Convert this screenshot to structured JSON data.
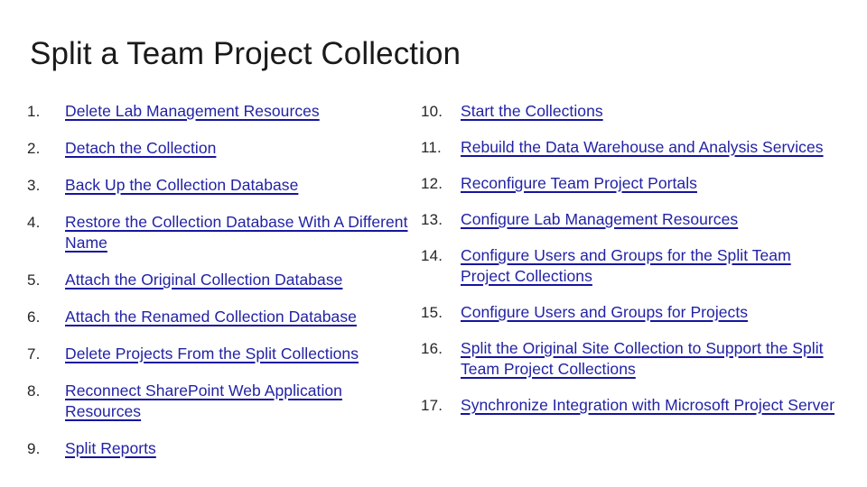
{
  "slide": {
    "title": "Split a Team Project Collection",
    "background_color": "#ffffff",
    "title_color": "#1a1a1a",
    "link_color": "#2222a6",
    "link_underline_color": "#1515a0",
    "number_color": "#262626"
  },
  "columns": {
    "left": {
      "items": [
        {
          "number": "1.",
          "label": "Delete Lab Management Resources"
        },
        {
          "number": "2.",
          "label": "Detach the Collection"
        },
        {
          "number": "3.",
          "label": "Back Up the Collection Database"
        },
        {
          "number": "4.",
          "label": "Restore the Collection Database With A Different Name"
        },
        {
          "number": "5.",
          "label": "Attach the Original Collection Database"
        },
        {
          "number": "6.",
          "label": "Attach the Renamed Collection Database"
        },
        {
          "number": "7.",
          "label": "Delete Projects From the Split Collections"
        },
        {
          "number": "8.",
          "label": "Reconnect SharePoint Web Application Resources"
        },
        {
          "number": "9.",
          "label": "Split Reports"
        }
      ]
    },
    "right": {
      "items": [
        {
          "number": "10.",
          "label": "Start the Collections"
        },
        {
          "number": "11.",
          "label": "Rebuild the Data Warehouse and Analysis Services"
        },
        {
          "number": "12.",
          "label": "Reconfigure Team Project Portals"
        },
        {
          "number": "13.",
          "label": "Configure Lab Management Resources"
        },
        {
          "number": "14.",
          "label": "Configure Users and Groups for the Split Team Project Collections"
        },
        {
          "number": "15.",
          "label": "Configure Users and Groups for Projects"
        },
        {
          "number": "16.",
          "label": "Split the Original Site Collection to Support the Split Team Project Collections"
        },
        {
          "number": "17.",
          "label": "Synchronize Integration with Microsoft Project Server"
        }
      ]
    }
  }
}
